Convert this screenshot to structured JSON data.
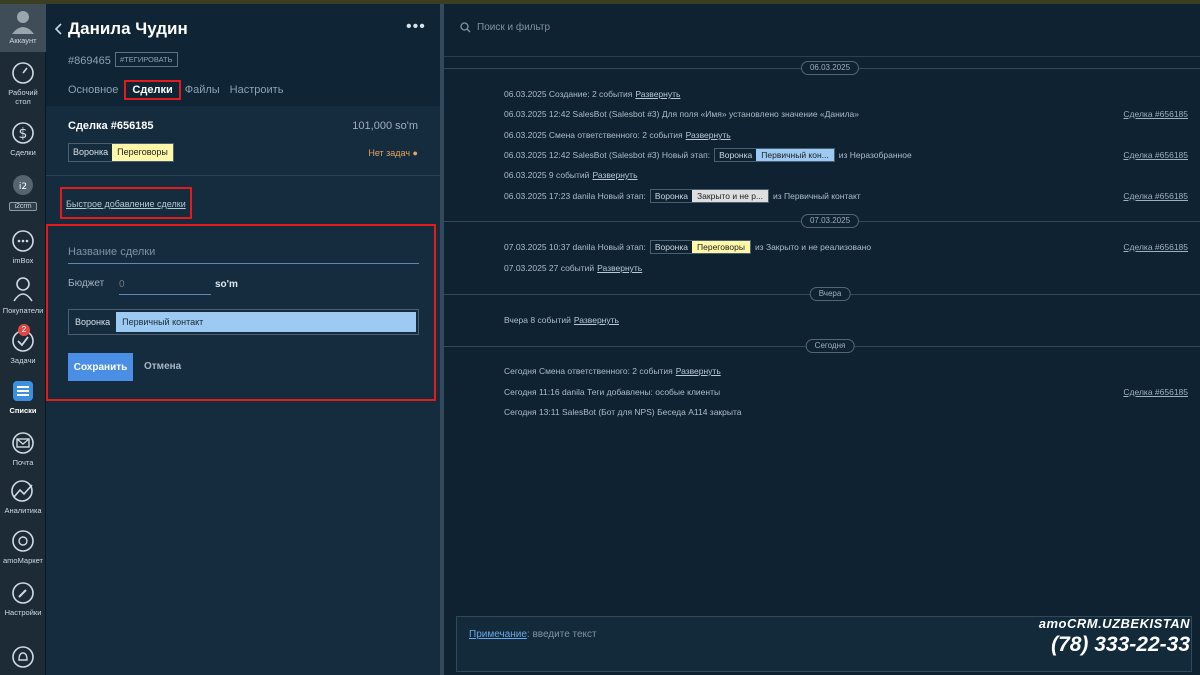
{
  "nav": {
    "account": "Аккаунт",
    "dashboard": "Рабочий стол",
    "deals": "Сделки",
    "i2crm": "i2crm",
    "imbox": "imBox",
    "customers": "Покупатели",
    "tasks": "Задачи",
    "tasks_badge": "2",
    "lists": "Списки",
    "mail": "Почта",
    "analytics": "Аналитика",
    "market": "amoМаркет",
    "settings": "Настройки"
  },
  "contact": {
    "name": "Данила Чудин",
    "id": "#869465",
    "tag_button": "#ТЕГИРОВАТЬ",
    "more": "•••",
    "tabs": [
      {
        "label": "Основное"
      },
      {
        "label": "Сделки"
      },
      {
        "label": "Файлы"
      },
      {
        "label": "Настроить"
      }
    ]
  },
  "deal": {
    "title": "Сделка #656185",
    "budget": "101,000 so'm",
    "pipeline": "Воронка",
    "stage": "Переговоры",
    "no_tasks": "Нет задач ●"
  },
  "quick_add": "Быстрое добавление сделки",
  "form": {
    "name_placeholder": "Название сделки",
    "budget_label": "Бюджет",
    "budget_value": "0",
    "currency": "so'm",
    "pipeline": "Воронка",
    "stage": "Первичный контакт",
    "save": "Сохранить",
    "cancel": "Отмена"
  },
  "feed": {
    "search_placeholder": "Поиск и фильтр",
    "dates": [
      "06.03.2025",
      "07.03.2025",
      "Вчера",
      "Сегодня"
    ],
    "expand": "Развернуть",
    "deal_link": "Сделка #656185",
    "events": [
      {
        "text": "06.03.2025 Создание: 2 события"
      },
      {
        "text": "06.03.2025 12:42 SalesBot (Salesbot #3) Для поля «Имя» установлено значение «Данила»"
      },
      {
        "text": "06.03.2025 Смена ответственного: 2 события"
      },
      {
        "pre": "06.03.2025 12:42 SalesBot (Salesbot #3) Новый этап:",
        "pipe": "Воронка",
        "stage": "Первичный кон...",
        "post": "из Неразобранное"
      },
      {
        "text": "06.03.2025 9 событий"
      },
      {
        "pre": "06.03.2025 17:23 danila Новый этап:",
        "pipe": "Воронка",
        "stage": "Закрыто и не р...",
        "post": "из Первичный контакт"
      },
      {
        "pre": "07.03.2025 10:37 danila Новый этап:",
        "pipe": "Воронка",
        "stage": "Переговоры",
        "post": "из Закрыто и не реализовано"
      },
      {
        "text": "07.03.2025 27 событий"
      },
      {
        "text": "Вчера 8 событий"
      },
      {
        "text": "Сегодня Смена ответственного: 2 события"
      },
      {
        "text": "Сегодня 11:16 danila Теги добавлены: особые клиенты"
      },
      {
        "text": "Сегодня 13:11 SalesBot (Бот для NPS) Беседа A114 закрыта"
      }
    ],
    "note_label": "Примечание",
    "note_placeholder": ": введите текст"
  },
  "brand": {
    "line1": "amoCRM.UZBEKISTAN",
    "phone": "(78) 333-22-33"
  },
  "colors": {
    "accent": "#4a8ee6",
    "highlight": "#e41b1b",
    "stage_negotiation": "#fff8a8",
    "stage_primary": "#9ccaf2",
    "stage_closed": "#dedede"
  }
}
